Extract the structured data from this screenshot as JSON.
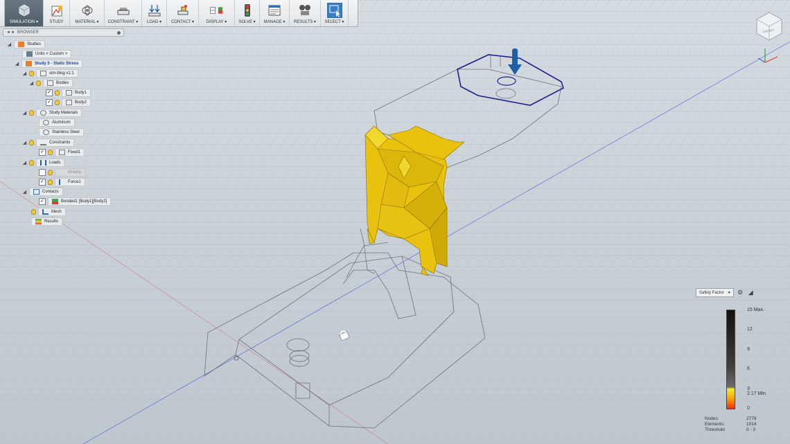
{
  "toolbar": {
    "workspace": "SIMULATION ▾",
    "buttons": [
      {
        "label": "STUDY",
        "icon": "study-icon"
      },
      {
        "label": "MATERIAL ▾",
        "icon": "material-icon"
      },
      {
        "label": "CONSTRAINT ▾",
        "icon": "constraint-icon"
      },
      {
        "label": "LOAD ▾",
        "icon": "load-icon"
      },
      {
        "label": "CONTACT ▾",
        "icon": "contact-icon"
      },
      {
        "label": "DISPLAY ▾",
        "icon": "display-icon"
      },
      {
        "label": "SOLVE ▾",
        "icon": "solve-icon"
      },
      {
        "label": "MANAGE ▾",
        "icon": "manage-icon"
      },
      {
        "label": "RESULTS ▾",
        "icon": "results-icon"
      },
      {
        "label": "SELECT ▾",
        "icon": "select-icon"
      }
    ]
  },
  "browser": {
    "title": "BROWSER",
    "tree": [
      {
        "label": "Studies"
      },
      {
        "label": "Units < Custom >"
      },
      {
        "label": "Study 5 - Static Stress"
      },
      {
        "label": "sim-blog v1:1"
      },
      {
        "label": "Bodies"
      },
      {
        "label": "Body1"
      },
      {
        "label": "Body2"
      },
      {
        "label": "Study Materials"
      },
      {
        "label": "Aluminum"
      },
      {
        "label": "Stainless Steel"
      },
      {
        "label": "Constraints"
      },
      {
        "label": "Fixed1"
      },
      {
        "label": "Loads"
      },
      {
        "label": "Gravity"
      },
      {
        "label": "Force1"
      },
      {
        "label": "Contacts"
      },
      {
        "label": "Bonded1 [Body1][Body2]"
      },
      {
        "label": "Mesh"
      },
      {
        "label": "Results"
      }
    ]
  },
  "viewcube": {
    "label": "FRONT"
  },
  "legend": {
    "type": "Safety Factor",
    "ticks": [
      "15 Max.",
      "12",
      "9",
      "6",
      "3",
      "2.17 Min.",
      "0"
    ],
    "stats_labels": [
      "Nodes:",
      "Elements:",
      "Threshold"
    ],
    "stats_values": [
      "2778",
      "1014",
      "0 - 3"
    ]
  },
  "colors": {
    "accent": "#1f6fbf",
    "result_fill": "#e8c20f",
    "load_arrow": "#1f5fa8",
    "face_outline": "#1a1f8f"
  }
}
